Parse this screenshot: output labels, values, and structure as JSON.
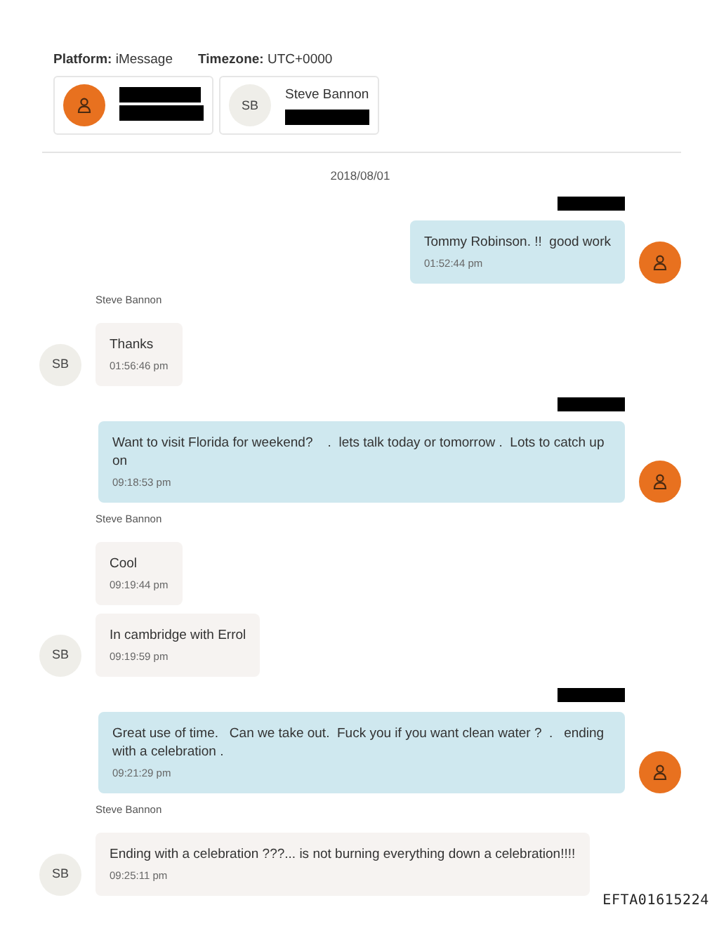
{
  "header": {
    "platform_label": "Platform:",
    "platform": "iMessage",
    "timezone_label": "Timezone:",
    "timezone": "UTC+0000"
  },
  "participants": [
    {
      "avatar": {
        "kind": "person"
      },
      "lines": [
        {
          "kind": "redacted"
        },
        {
          "kind": "redacted"
        }
      ]
    },
    {
      "avatar": {
        "kind": "initials",
        "text": "SB"
      },
      "lines": [
        {
          "kind": "text",
          "text": "Steve Bannon"
        },
        {
          "kind": "redacted"
        }
      ]
    }
  ],
  "date": "2018/08/01",
  "groups": [
    {
      "kind": "outgoing",
      "sender": {
        "kind": "redacted"
      },
      "avatar": {
        "kind": "person"
      },
      "messages": [
        {
          "text": "Tommy Robinson. !!  good work",
          "time": "01:52:44 pm"
        }
      ]
    },
    {
      "kind": "incoming",
      "sender": {
        "kind": "text",
        "text": "Steve Bannon"
      },
      "avatar": {
        "kind": "initials",
        "text": "SB"
      },
      "messages": [
        {
          "text": "Thanks",
          "time": "01:56:46 pm"
        }
      ]
    },
    {
      "kind": "outgoing",
      "sender": {
        "kind": "redacted"
      },
      "avatar": {
        "kind": "person"
      },
      "messages": [
        {
          "text": "Want to visit Florida for weekend?    .  lets talk today or tomorrow .  Lots to catch up on",
          "time": "09:18:53 pm"
        }
      ]
    },
    {
      "kind": "incoming",
      "sender": {
        "kind": "text",
        "text": "Steve Bannon"
      },
      "avatar": {
        "kind": "initials",
        "text": "SB"
      },
      "messages": [
        {
          "text": "Cool",
          "time": "09:19:44 pm"
        },
        {
          "text": "In cambridge with Errol",
          "time": "09:19:59 pm"
        }
      ]
    },
    {
      "kind": "outgoing",
      "sender": {
        "kind": "redacted"
      },
      "avatar": {
        "kind": "person"
      },
      "messages": [
        {
          "text": "Great use of time.   Can we take out.  Fuck you if you want clean water ?  .   ending with a celebration .",
          "time": "09:21:29 pm"
        }
      ]
    },
    {
      "kind": "incoming",
      "sender": {
        "kind": "text",
        "text": "Steve Bannon"
      },
      "avatar": {
        "kind": "initials",
        "text": "SB"
      },
      "messages": [
        {
          "text": "Ending with a celebration ???... is not burning everything down a celebration!!!!",
          "time": "09:25:11 pm"
        }
      ]
    }
  ],
  "document_id": "EFTA01615224"
}
